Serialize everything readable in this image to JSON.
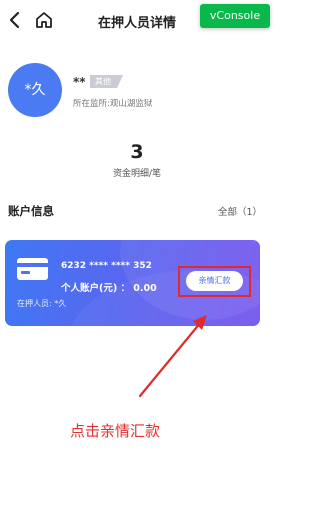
{
  "header": {
    "title": "在押人员详情",
    "vconsole_label": "vConsole"
  },
  "profile": {
    "avatar_text": "*久",
    "name": "**",
    "badge": "其他",
    "facility": "所在监所:观山湖监狱"
  },
  "stats": {
    "count": "3",
    "label": "资金明细/笔"
  },
  "accounts_section": {
    "title": "账户信息",
    "all_label": "全部（1）"
  },
  "account_card": {
    "number": "6232 **** **** 352",
    "balance_text": "个人账户(元) ：  0.00",
    "holder": "在押人员: *久",
    "remit_button": "亲情汇款"
  },
  "annotation": {
    "instruction": "点击亲情汇款",
    "color": "#e53030"
  },
  "colors": {
    "vconsole": "#09b84b",
    "avatar": "#4b7bf3",
    "card_start": "#3f78f2",
    "card_end": "#7656ee"
  },
  "icons": [
    "back-arrow-icon",
    "home-icon",
    "bank-card-icon"
  ]
}
